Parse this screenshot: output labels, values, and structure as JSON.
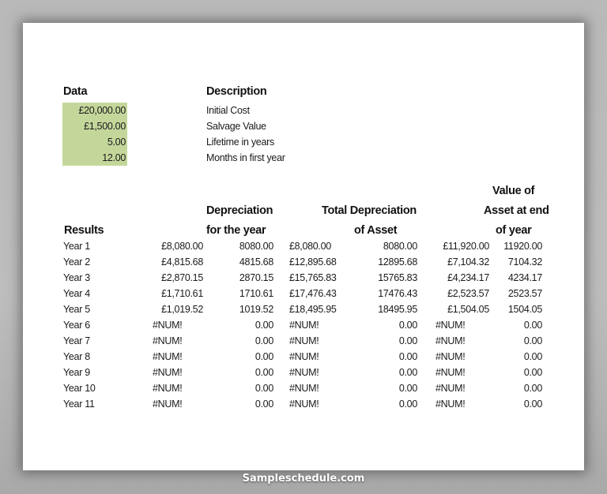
{
  "inputs": {
    "data_header": "Data",
    "description_header": "Description",
    "rows": [
      {
        "value": "£20,000.00",
        "description": "Initial Cost"
      },
      {
        "value": "£1,500.00",
        "description": "Salvage Value"
      },
      {
        "value": "5.00",
        "description": "Lifetime in years"
      },
      {
        "value": "12.00",
        "description": "Months in first year"
      }
    ],
    "input_fill_color": "#c4d79b"
  },
  "results": {
    "results_header": "Results",
    "depreciation_header": [
      "Depreciation",
      "for the year"
    ],
    "total_header": [
      "Total Depreciation",
      "of Asset"
    ],
    "value_header": [
      "Value of",
      "Asset at end",
      "of year"
    ],
    "rows": [
      {
        "year": "Year 1",
        "dep_fmt": "£8,080.00",
        "dep": "8080.00",
        "tot_fmt": "£8,080.00",
        "tot": "8080.00",
        "val_fmt": "£11,920.00",
        "val": "11920.00"
      },
      {
        "year": "Year 2",
        "dep_fmt": "£4,815.68",
        "dep": "4815.68",
        "tot_fmt": "£12,895.68",
        "tot": "12895.68",
        "val_fmt": "£7,104.32",
        "val": "7104.32"
      },
      {
        "year": "Year 3",
        "dep_fmt": "£2,870.15",
        "dep": "2870.15",
        "tot_fmt": "£15,765.83",
        "tot": "15765.83",
        "val_fmt": "£4,234.17",
        "val": "4234.17"
      },
      {
        "year": "Year 4",
        "dep_fmt": "£1,710.61",
        "dep": "1710.61",
        "tot_fmt": "£17,476.43",
        "tot": "17476.43",
        "val_fmt": "£2,523.57",
        "val": "2523.57"
      },
      {
        "year": "Year 5",
        "dep_fmt": "£1,019.52",
        "dep": "1019.52",
        "tot_fmt": "£18,495.95",
        "tot": "18495.95",
        "val_fmt": "£1,504.05",
        "val": "1504.05"
      },
      {
        "year": "Year 6",
        "dep_fmt": "#NUM!",
        "dep": "0.00",
        "tot_fmt": "#NUM!",
        "tot": "0.00",
        "val_fmt": "#NUM!",
        "val": "0.00"
      },
      {
        "year": "Year 7",
        "dep_fmt": "#NUM!",
        "dep": "0.00",
        "tot_fmt": "#NUM!",
        "tot": "0.00",
        "val_fmt": "#NUM!",
        "val": "0.00"
      },
      {
        "year": "Year 8",
        "dep_fmt": "#NUM!",
        "dep": "0.00",
        "tot_fmt": "#NUM!",
        "tot": "0.00",
        "val_fmt": "#NUM!",
        "val": "0.00"
      },
      {
        "year": "Year 9",
        "dep_fmt": "#NUM!",
        "dep": "0.00",
        "tot_fmt": "#NUM!",
        "tot": "0.00",
        "val_fmt": "#NUM!",
        "val": "0.00"
      },
      {
        "year": "Year 10",
        "dep_fmt": "#NUM!",
        "dep": "0.00",
        "tot_fmt": "#NUM!",
        "tot": "0.00",
        "val_fmt": "#NUM!",
        "val": "0.00"
      },
      {
        "year": "Year 11",
        "dep_fmt": "#NUM!",
        "dep": "0.00",
        "tot_fmt": "#NUM!",
        "tot": "0.00",
        "val_fmt": "#NUM!",
        "val": "0.00"
      }
    ]
  },
  "footer": {
    "watermark": "Sampleschedule.com"
  }
}
